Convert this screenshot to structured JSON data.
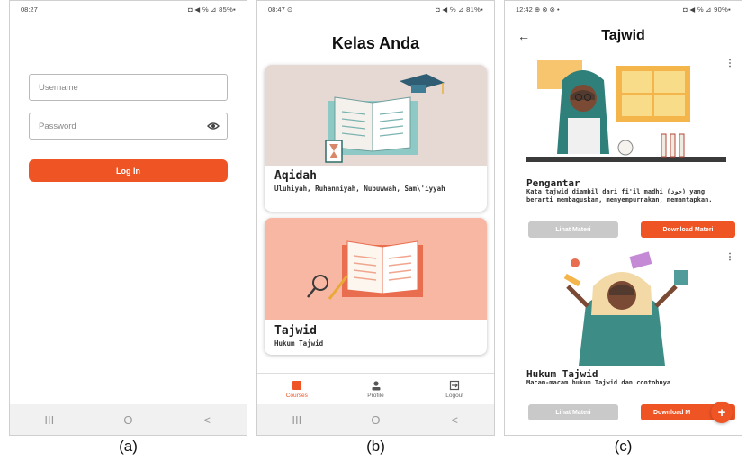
{
  "captions": [
    "(a)",
    "(b)",
    "(c)"
  ],
  "login": {
    "status_time": "08:27",
    "status_right": "◘ ◀ ℅ ⊿ 85%▪",
    "username_placeholder": "Username",
    "password_placeholder": "Password",
    "login_label": "Log In"
  },
  "classes": {
    "status_time": "08:47 ⊙",
    "status_right": "◘ ◀ ℅ ⊿ 81%▪",
    "title": "Kelas Anda",
    "cards": [
      {
        "title": "Aqidah",
        "subtitle": "Uluhiyah, Ruhanniyah, Nubuwwah, Sam\\'iyyah"
      },
      {
        "title": "Tajwid",
        "subtitle": "Hukum Tajwid"
      }
    ],
    "nav": [
      {
        "label": "Courses",
        "icon": "book-icon"
      },
      {
        "label": "Profile",
        "icon": "person-icon"
      },
      {
        "label": "Logout",
        "icon": "logout-icon"
      }
    ]
  },
  "detail": {
    "status_time": "12:42 ⊕ ⊗ ⊗ •",
    "status_right": "◘ ◀ ℅ ⊿ 90%▪",
    "back": "←",
    "title": "Tajwid",
    "materials": [
      {
        "title": "Pengantar",
        "subtitle": "Kata tajwid diambil dari fi'il madhi (جود) yang berarti membaguskan, menyempurnakan, memantapkan.",
        "view_label": "Lihat Materi",
        "download_label": "Download Materi"
      },
      {
        "title": "Hukum Tajwid",
        "subtitle": "Macam-macam hukum Tajwid dan contohnya",
        "view_label": "Lihat Materi",
        "download_label": "Download M"
      }
    ],
    "fab_label": "+"
  },
  "system_nav": {
    "recent": "III",
    "home": "O",
    "back": "<"
  },
  "colors": {
    "accent": "#ef5424",
    "card1_bg": "#e6d8d3",
    "card2_bg": "#f8b7a3"
  }
}
